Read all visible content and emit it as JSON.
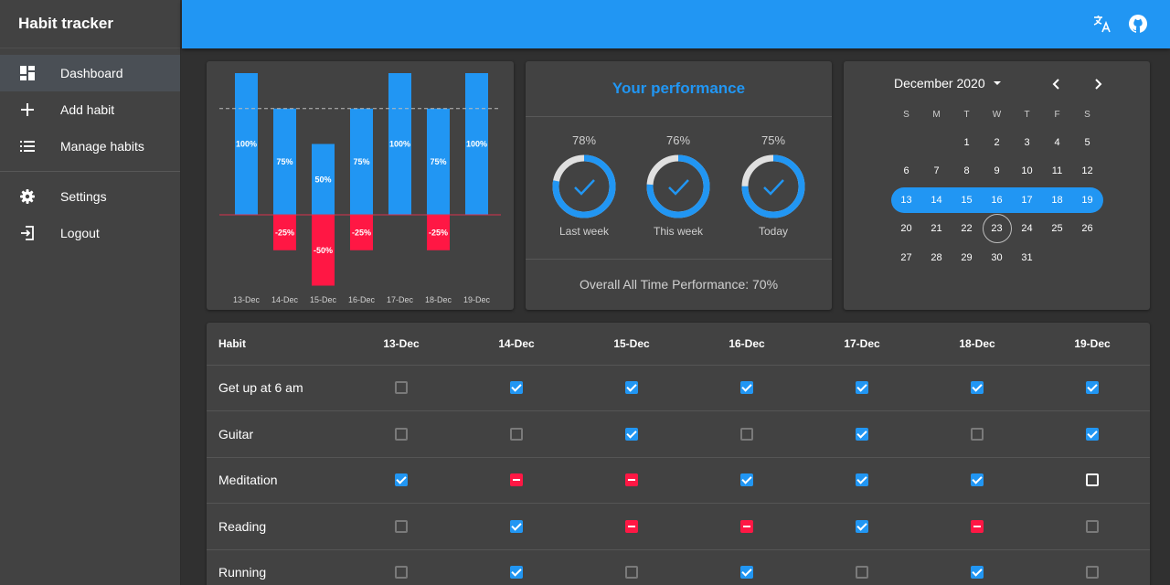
{
  "app": {
    "title": "Habit tracker"
  },
  "sidebar": {
    "items": [
      {
        "label": "Dashboard",
        "icon": "dashboard-icon",
        "active": true
      },
      {
        "label": "Add habit",
        "icon": "plus-icon"
      },
      {
        "label": "Manage habits",
        "icon": "list-icon"
      },
      {
        "label": "Settings",
        "icon": "gear-icon"
      },
      {
        "label": "Logout",
        "icon": "logout-icon"
      }
    ]
  },
  "topbar": {
    "icons": [
      "translate-icon",
      "github-icon"
    ]
  },
  "colors": {
    "accent": "#2196f3",
    "danger": "#ff1744",
    "background": "#303030",
    "card": "#424242"
  },
  "chart_data": {
    "type": "bar",
    "categories": [
      "13-Dec",
      "14-Dec",
      "15-Dec",
      "16-Dec",
      "17-Dec",
      "18-Dec",
      "19-Dec"
    ],
    "series": [
      {
        "values": [
          100,
          75,
          50,
          75,
          100,
          75,
          100
        ],
        "color": "#2196f3"
      },
      {
        "values": [
          0,
          -25,
          -50,
          -25,
          0,
          -25,
          0
        ],
        "color": "#ff1744"
      }
    ],
    "data_labels": {
      "positive": [
        "100%",
        "75%",
        "50%",
        "75%",
        "100%",
        "75%",
        "100%"
      ],
      "negative": [
        "",
        "-25%",
        "-50%",
        "-25%",
        "",
        "-25%",
        ""
      ]
    },
    "ylim": [
      -50,
      100
    ],
    "reference_line": 75,
    "title": "",
    "xlabel": "",
    "ylabel": ""
  },
  "performance": {
    "title": "Your performance",
    "rings": [
      {
        "percent_label": "78%",
        "value": 78,
        "label": "Last week"
      },
      {
        "percent_label": "76%",
        "value": 76,
        "label": "This week"
      },
      {
        "percent_label": "75%",
        "value": 75,
        "label": "Today"
      }
    ],
    "overall": "Overall All Time Performance: 70%"
  },
  "calendar": {
    "month_label": "December 2020",
    "weekdays": [
      "S",
      "M",
      "T",
      "W",
      "T",
      "F",
      "S"
    ],
    "weeks": [
      [
        "",
        "",
        "1",
        "2",
        "3",
        "4",
        "5"
      ],
      [
        "6",
        "7",
        "8",
        "9",
        "10",
        "11",
        "12"
      ],
      [
        "13",
        "14",
        "15",
        "16",
        "17",
        "18",
        "19"
      ],
      [
        "20",
        "21",
        "22",
        "23",
        "24",
        "25",
        "26"
      ],
      [
        "27",
        "28",
        "29",
        "30",
        "31",
        "",
        ""
      ]
    ],
    "selected_week_index": 2,
    "today": "23"
  },
  "habits_table": {
    "header": [
      "Habit",
      "13-Dec",
      "14-Dec",
      "15-Dec",
      "16-Dec",
      "17-Dec",
      "18-Dec",
      "19-Dec"
    ],
    "rows": [
      {
        "name": "Get up at 6 am",
        "states": [
          "empty",
          "checked",
          "checked",
          "checked",
          "checked",
          "checked",
          "checked"
        ]
      },
      {
        "name": "Guitar",
        "states": [
          "empty",
          "empty",
          "checked",
          "empty",
          "checked",
          "empty",
          "checked"
        ]
      },
      {
        "name": "Meditation",
        "states": [
          "checked",
          "fail",
          "fail",
          "checked",
          "checked",
          "checked",
          "white"
        ]
      },
      {
        "name": "Reading",
        "states": [
          "empty",
          "checked",
          "fail",
          "fail",
          "checked",
          "fail",
          "empty"
        ]
      },
      {
        "name": "Running",
        "states": [
          "empty",
          "checked",
          "empty",
          "checked",
          "empty",
          "checked",
          "empty"
        ]
      }
    ]
  }
}
